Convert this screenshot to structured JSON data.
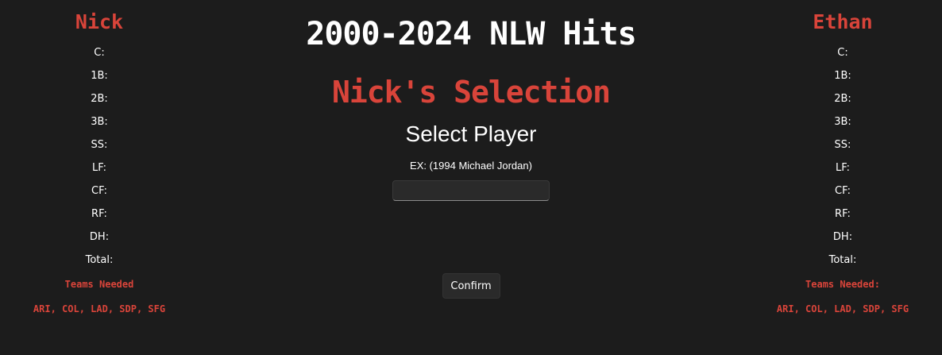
{
  "app": {
    "title": "2000-2024 NLW Hits",
    "selection_title": "Nick's Selection",
    "select_heading": "Select Player",
    "example_text": "EX: (1994 Michael Jordan)",
    "input": {
      "value": "",
      "placeholder": ""
    },
    "confirm_label": "Confirm"
  },
  "left_panel": {
    "player_name": "Nick",
    "positions": [
      "C:",
      "1B:",
      "2B:",
      "3B:",
      "SS:",
      "LF:",
      "CF:",
      "RF:",
      "DH:",
      "Total:"
    ],
    "teams_label": "Teams Needed",
    "teams": "ARI, COL, LAD, SDP, SFG"
  },
  "right_panel": {
    "player_name": "Ethan",
    "positions": [
      "C:",
      "1B:",
      "2B:",
      "3B:",
      "SS:",
      "LF:",
      "CF:",
      "RF:",
      "DH:",
      "Total:"
    ],
    "teams_label": "Teams Needed:",
    "teams": "ARI, COL, LAD, SDP, SFG"
  },
  "colors": {
    "background": "#1c1c1c",
    "accent_red": "#d9443a",
    "text": "#ffffff"
  }
}
